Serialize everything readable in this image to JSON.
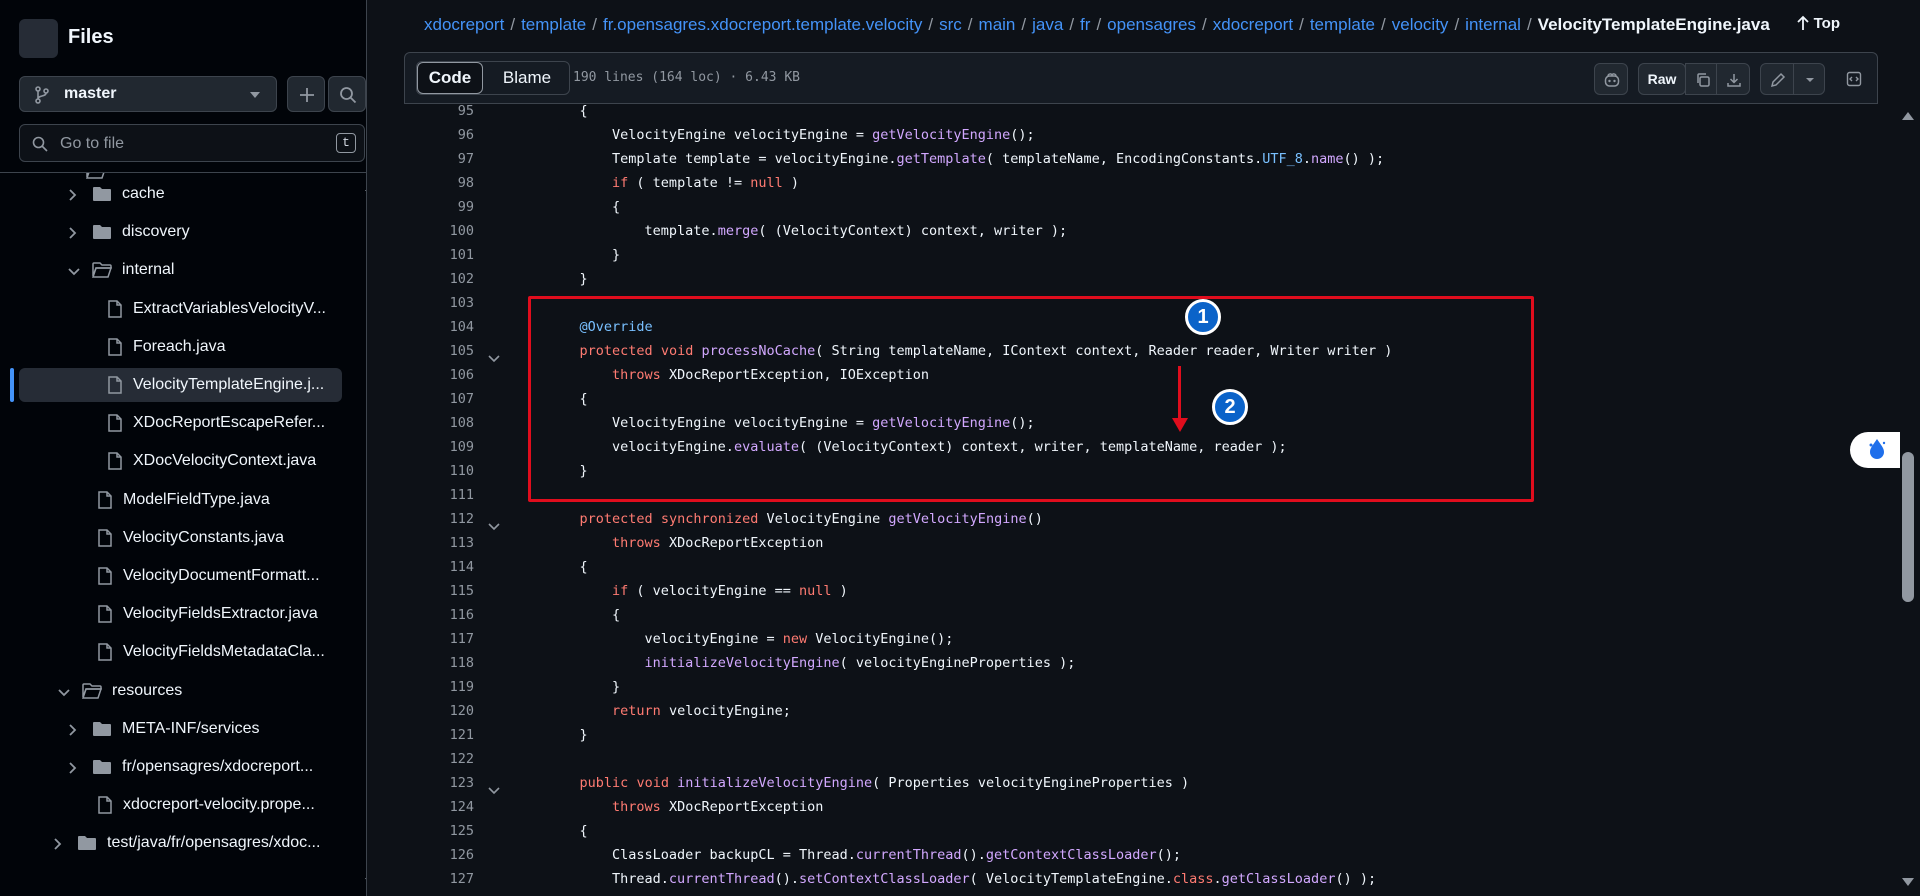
{
  "sidebar": {
    "title": "Files",
    "branch": "master",
    "goto_placeholder": "Go to file",
    "goto_shortcut": "t",
    "tree": [
      {
        "label": "cache",
        "type": "folder",
        "expanded": false
      },
      {
        "label": "discovery",
        "type": "folder",
        "expanded": false
      },
      {
        "label": "internal",
        "type": "folder",
        "expanded": true
      },
      {
        "label": "ExtractVariablesVelocityV...",
        "type": "file"
      },
      {
        "label": "Foreach.java",
        "type": "file"
      },
      {
        "label": "VelocityTemplateEngine.j...",
        "type": "file",
        "selected": true
      },
      {
        "label": "XDocReportEscapeRefer...",
        "type": "file"
      },
      {
        "label": "XDocVelocityContext.java",
        "type": "file"
      },
      {
        "label": "ModelFieldType.java",
        "type": "file"
      },
      {
        "label": "VelocityConstants.java",
        "type": "file"
      },
      {
        "label": "VelocityDocumentFormatt...",
        "type": "file"
      },
      {
        "label": "VelocityFieldsExtractor.java",
        "type": "file"
      },
      {
        "label": "VelocityFieldsMetadataCla...",
        "type": "file"
      },
      {
        "label": "resources",
        "type": "folder",
        "expanded": true
      },
      {
        "label": "META-INF/services",
        "type": "folder",
        "expanded": false
      },
      {
        "label": "fr/opensagres/xdocreport...",
        "type": "folder",
        "expanded": false
      },
      {
        "label": "xdocreport-velocity.prope...",
        "type": "file"
      },
      {
        "label": "test/java/fr/opensagres/xdoc...",
        "type": "folder",
        "expanded": false
      }
    ]
  },
  "breadcrumb": {
    "parts": [
      "xdocreport",
      "template",
      "fr.opensagres.xdocreport.template.velocity",
      "src",
      "main",
      "java",
      "fr",
      "opensagres",
      "xdocreport",
      "template",
      "velocity",
      "internal"
    ],
    "current": "VelocityTemplateEngine.java",
    "top_label": "Top"
  },
  "toolbar": {
    "code_label": "Code",
    "blame_label": "Blame",
    "meta": "190 lines (164 loc) · 6.43 KB",
    "raw_label": "Raw"
  },
  "annotations": {
    "badge1": "1",
    "badge2": "2",
    "box_color": "#e00d1d"
  },
  "code": [
    {
      "n": "95",
      "t": "    {"
    },
    {
      "n": "96",
      "t": "        VelocityEngine velocityEngine = getVelocityEngine();"
    },
    {
      "n": "97",
      "t": "        Template template = velocityEngine.getTemplate( templateName, EncodingConstants.UTF_8.name() );"
    },
    {
      "n": "98",
      "t": "        if ( template != null )"
    },
    {
      "n": "99",
      "t": "        {"
    },
    {
      "n": "100",
      "t": "            template.merge( (VelocityContext) context, writer );"
    },
    {
      "n": "101",
      "t": "        }"
    },
    {
      "n": "102",
      "t": "    }"
    },
    {
      "n": "103",
      "t": ""
    },
    {
      "n": "104",
      "t": "    @Override"
    },
    {
      "n": "105",
      "t": "    protected void processNoCache( String templateName, IContext context, Reader reader, Writer writer )",
      "fold": true
    },
    {
      "n": "106",
      "t": "        throws XDocReportException, IOException"
    },
    {
      "n": "107",
      "t": "    {"
    },
    {
      "n": "108",
      "t": "        VelocityEngine velocityEngine = getVelocityEngine();"
    },
    {
      "n": "109",
      "t": "        velocityEngine.evaluate( (VelocityContext) context, writer, templateName, reader );"
    },
    {
      "n": "110",
      "t": "    }"
    },
    {
      "n": "111",
      "t": ""
    },
    {
      "n": "112",
      "t": "    protected synchronized VelocityEngine getVelocityEngine()",
      "fold": true
    },
    {
      "n": "113",
      "t": "        throws XDocReportException"
    },
    {
      "n": "114",
      "t": "    {"
    },
    {
      "n": "115",
      "t": "        if ( velocityEngine == null )"
    },
    {
      "n": "116",
      "t": "        {"
    },
    {
      "n": "117",
      "t": "            velocityEngine = new VelocityEngine();"
    },
    {
      "n": "118",
      "t": "            initializeVelocityEngine( velocityEngineProperties );"
    },
    {
      "n": "119",
      "t": "        }"
    },
    {
      "n": "120",
      "t": "        return velocityEngine;"
    },
    {
      "n": "121",
      "t": "    }"
    },
    {
      "n": "122",
      "t": ""
    },
    {
      "n": "123",
      "t": "    public void initializeVelocityEngine( Properties velocityEngineProperties )",
      "fold": true
    },
    {
      "n": "124",
      "t": "        throws XDocReportException"
    },
    {
      "n": "125",
      "t": "    {"
    },
    {
      "n": "126",
      "t": "        ClassLoader backupCL = Thread.currentThread().getContextClassLoader();"
    },
    {
      "n": "127",
      "t": "        Thread.currentThread().setContextClassLoader( VelocityTemplateEngine.class.getClassLoader() );"
    }
  ]
}
